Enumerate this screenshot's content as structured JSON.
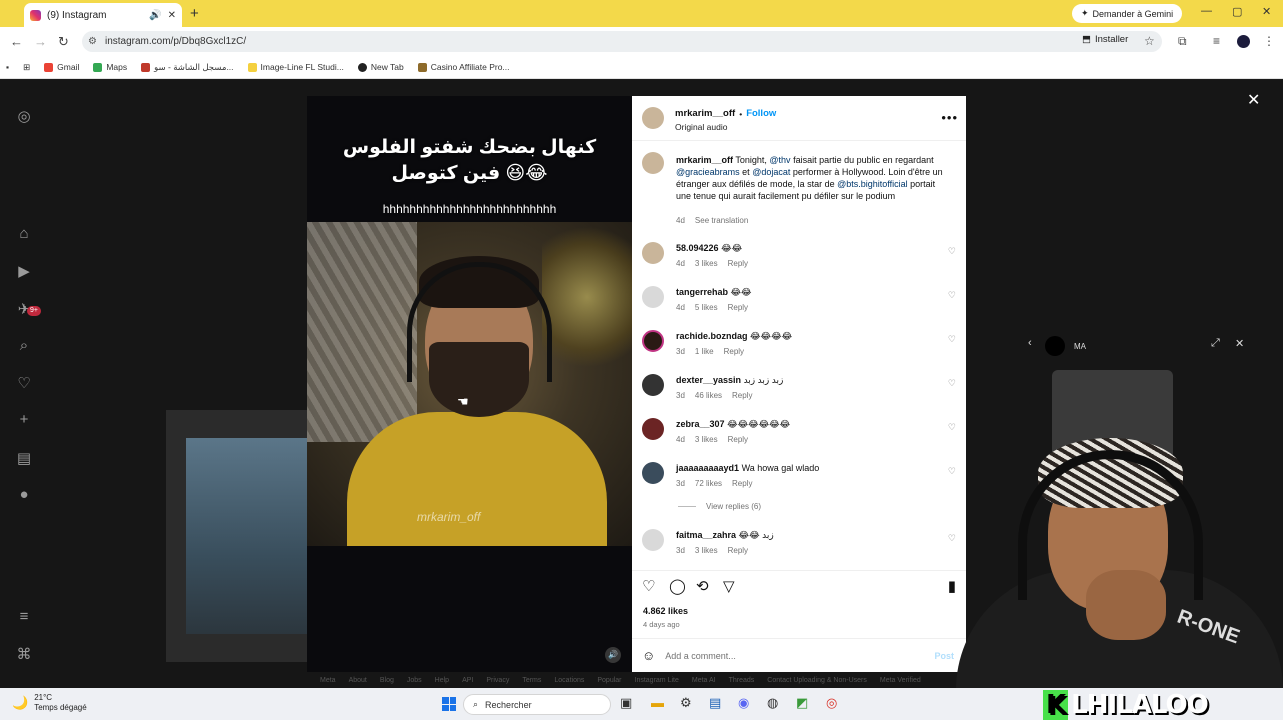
{
  "browser": {
    "tab_title": "(9) Instagram",
    "gemini_label": "Demander à Gemini",
    "url": "instagram.com/p/Dbq8Gxcl1zC/",
    "install_label": "Installer",
    "bookmarks": [
      {
        "label": "Gmail",
        "color": "#ea4335"
      },
      {
        "label": "Maps",
        "color": "#34a853"
      },
      {
        "label": "مسجل الشاشة - سو...",
        "color": "#c0392b"
      },
      {
        "label": "Image-Line FL Studi...",
        "color": "#f4d03f"
      },
      {
        "label": "New Tab",
        "color": "#222222"
      },
      {
        "label": "Casino Affiliate Pro...",
        "color": "#8e6b2b"
      }
    ]
  },
  "video": {
    "overlay_line1": "كنهال بضحك شفتو الفلوس",
    "overlay_line2": "فين كتوصل 😆😂",
    "overlay_line3": "hhhhhhhhhhhhhhhhhhhhhhhhhh",
    "watermark": "mrkarim_off"
  },
  "post": {
    "author": "mrkarim__off",
    "follow_label": "Follow",
    "audio": "Original audio",
    "caption_user": "mrkarim__off",
    "caption_parts": {
      "p1": " Tonight, ",
      "m1": "@thv",
      "p2": " faisait partie du public en regardant ",
      "m2": "@gracieabrams",
      "p3": " et ",
      "m3": "@dojacat",
      "p4": " performer à Hollywood. Loin d'être un étranger aux défilés de mode, la star de ",
      "m4": "@bts.bighitofficial",
      "p5": " portait une tenue qui aurait facilement pu défiler sur le podium"
    },
    "caption_time": "4d",
    "see_translation": "See translation",
    "likes": "4.862 likes",
    "date": "4 days ago",
    "add_comment_placeholder": "Add a comment...",
    "post_label": "Post"
  },
  "comments": [
    {
      "user": "58.094226",
      "text": "😂😂",
      "time": "4d",
      "likes": "3 likes",
      "reply": "Reply",
      "avatar": "c"
    },
    {
      "user": "tangerrehab",
      "text": "😂😂",
      "time": "4d",
      "likes": "5 likes",
      "reply": "Reply",
      "avatar": "gray"
    },
    {
      "user": "rachide.bozndag",
      "text": "😂😂😂😂",
      "time": "3d",
      "likes": "1 like",
      "reply": "Reply",
      "avatar": "ring"
    },
    {
      "user": "dexter__yassin",
      "text": "زبد زبد زبد",
      "time": "3d",
      "likes": "46 likes",
      "reply": "Reply",
      "avatar": "dark"
    },
    {
      "user": "zebra__307",
      "text": "😂😂😂😂😂😂",
      "time": "4d",
      "likes": "3 likes",
      "reply": "Reply",
      "avatar": "red"
    },
    {
      "user": "jaaaaaaaaayd1",
      "text": "Wa howa gal wlado",
      "time": "3d",
      "likes": "72 likes",
      "reply": "Reply",
      "avatar": "blue"
    },
    {
      "user": "faitma__zahra",
      "text": "😂😂 زبد",
      "time": "3d",
      "likes": "3 likes",
      "reply": "Reply",
      "avatar": "gray"
    }
  ],
  "view_replies": "View replies (6)",
  "miniplayer": {
    "label": "MA"
  },
  "streamer": {
    "brand": "LHILALOO",
    "shirt_text": "R-ONE"
  },
  "taskbar": {
    "temp": "21°C",
    "weather": "Temps dégagé",
    "search_placeholder": "Rechercher"
  },
  "footer_links": [
    "Meta",
    "About",
    "Blog",
    "Jobs",
    "Help",
    "API",
    "Privacy",
    "Terms",
    "Locations",
    "Popular",
    "Instagram Lite",
    "Meta AI",
    "Threads",
    "Contact Uploading & Non-Users",
    "Meta Verified"
  ],
  "colors": {
    "accent_blue": "#0095f6",
    "tab_bar": "#f3d94a",
    "brand_green": "#48e04a"
  }
}
